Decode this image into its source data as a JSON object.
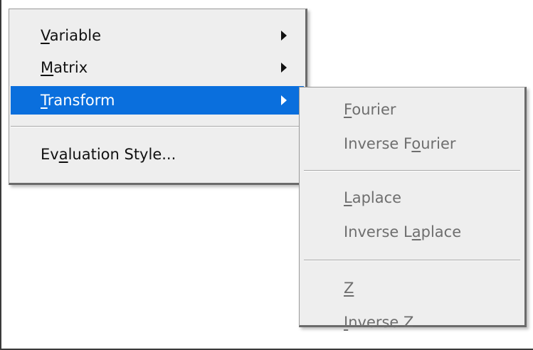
{
  "main_menu": {
    "items": [
      {
        "pre": "",
        "key": "V",
        "post": "ariable",
        "has_submenu": true,
        "selected": false
      },
      {
        "pre": "",
        "key": "M",
        "post": "atrix",
        "has_submenu": true,
        "selected": false
      },
      {
        "pre": "",
        "key": "T",
        "post": "ransform",
        "has_submenu": true,
        "selected": true
      },
      {
        "pre": "Ev",
        "key": "a",
        "post": "luation Style...",
        "has_submenu": false,
        "selected": false
      }
    ]
  },
  "submenu": {
    "items": [
      {
        "pre": "",
        "key": "F",
        "post": "ourier",
        "enabled": false
      },
      {
        "pre": "Inverse F",
        "key": "o",
        "post": "urier",
        "enabled": false
      },
      {
        "pre": "",
        "key": "L",
        "post": "aplace",
        "enabled": false
      },
      {
        "pre": "Inverse L",
        "key": "a",
        "post": "place",
        "enabled": false
      },
      {
        "pre": "",
        "key": "Z",
        "post": "",
        "enabled": false
      },
      {
        "pre": "",
        "key": "I",
        "post": "nverse Z",
        "enabled": false
      }
    ]
  },
  "colors": {
    "selection": "#0a6fdd",
    "menu_bg": "#eeeeee",
    "disabled_text": "#6e6e6e"
  }
}
